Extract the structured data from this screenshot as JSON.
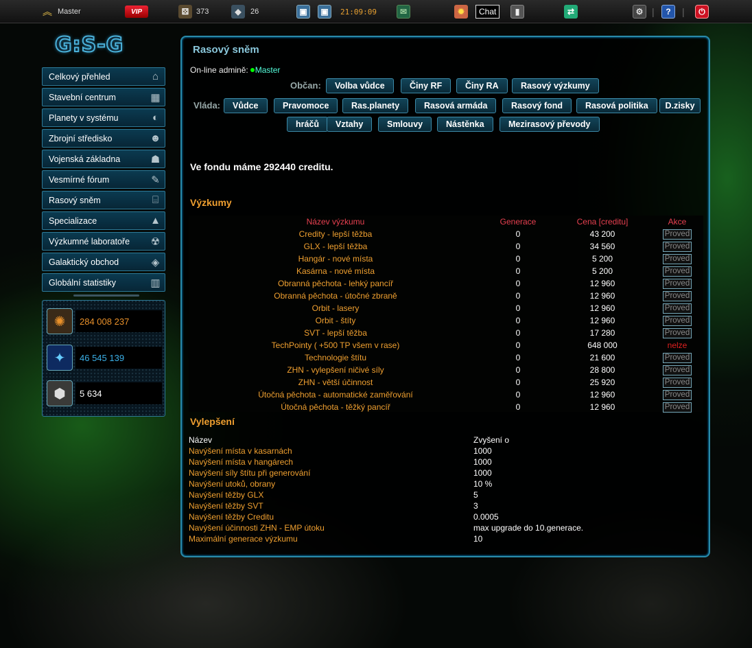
{
  "topbar": {
    "rank_icon": "rank-chevron-icon",
    "username": "Master",
    "vip": "VIP",
    "dice_value": "373",
    "ships_value": "26",
    "time": "21:09:09",
    "chat": "Chat"
  },
  "logo": "G:S-G",
  "sidebar": {
    "items": [
      {
        "label": "Celkový přehled",
        "icon": "home-icon"
      },
      {
        "label": "Stavební centrum",
        "icon": "building-icon"
      },
      {
        "label": "Planety v systému",
        "icon": "planet-icon"
      },
      {
        "label": "Zbrojní středisko",
        "icon": "soldier-icon"
      },
      {
        "label": "Vojenská základna",
        "icon": "base-icon"
      },
      {
        "label": "Vesmírné fórum",
        "icon": "forum-icon"
      },
      {
        "label": "Rasový sněm",
        "icon": "parliament-icon"
      },
      {
        "label": "Specializace",
        "icon": "specialization-icon"
      },
      {
        "label": "Výzkumné laboratoře",
        "icon": "radiation-icon"
      },
      {
        "label": "Galaktický obchod",
        "icon": "trade-icon"
      },
      {
        "label": "Globální statistiky",
        "icon": "stats-icon"
      }
    ]
  },
  "resources": {
    "credits": "284 008 237",
    "glx": "46 545 139",
    "svt": "5 634"
  },
  "colors": {
    "accent": "#2a8aa8",
    "orange": "#f0a030",
    "header_red": "#e84050",
    "credits": "#e8902a",
    "glx": "#3ab0e8"
  },
  "panel": {
    "title": "Rasový sněm",
    "online_label": "On-line admině:",
    "online_user": "Master",
    "obcan_label": "Občan:",
    "obcan_buttons": [
      "Volba vůdce",
      "Činy RF",
      "Činy RA",
      "Rasový výzkumy"
    ],
    "vlada_label": "Vláda:",
    "vlada_buttons": [
      "Vůdce",
      "Pravomoce",
      "Ras.planety",
      "Rasová armáda",
      "Rasový fond",
      "Rasová politika",
      "D.zisky",
      "hráčů",
      "Vztahy",
      "Smlouvy",
      "Nástěnka",
      "Mezirasový převody"
    ],
    "fund_text": "Ve fondu máme 292440 creditu."
  },
  "research": {
    "title": "Výzkumy",
    "headers": {
      "name": "Název výzkumu",
      "gen": "Generace",
      "cost": "Cena [creditu]",
      "action": "Akce"
    },
    "action_label": "Proved",
    "na_label": "nelze",
    "rows": [
      {
        "name": "Credity - lepší těžba",
        "gen": "0",
        "cost": "43 200",
        "available": true
      },
      {
        "name": "GLX - lepší těžba",
        "gen": "0",
        "cost": "34 560",
        "available": true
      },
      {
        "name": "Hangár - nové místa",
        "gen": "0",
        "cost": "5 200",
        "available": true
      },
      {
        "name": "Kasárna - nové místa",
        "gen": "0",
        "cost": "5 200",
        "available": true
      },
      {
        "name": "Obranná pěchota - lehký pancíř",
        "gen": "0",
        "cost": "12 960",
        "available": true
      },
      {
        "name": "Obranná pěchota - útočné zbraně",
        "gen": "0",
        "cost": "12 960",
        "available": true
      },
      {
        "name": "Orbit - lasery",
        "gen": "0",
        "cost": "12 960",
        "available": true
      },
      {
        "name": "Orbit - štíty",
        "gen": "0",
        "cost": "12 960",
        "available": true
      },
      {
        "name": "SVT - lepší těžba",
        "gen": "0",
        "cost": "17 280",
        "available": true
      },
      {
        "name": "TechPointy ( +500 TP všem v rase)",
        "gen": "0",
        "cost": "648 000",
        "available": false
      },
      {
        "name": "Technologie štítu",
        "gen": "0",
        "cost": "21 600",
        "available": true
      },
      {
        "name": "ZHN - vylepšení ničivé síly",
        "gen": "0",
        "cost": "28 800",
        "available": true
      },
      {
        "name": "ZHN - větší účinnost",
        "gen": "0",
        "cost": "25 920",
        "available": true
      },
      {
        "name": "Útočná pěchota - automatické zaměřování",
        "gen": "0",
        "cost": "12 960",
        "available": true
      },
      {
        "name": "Útočná pěchota - těžký pancíř",
        "gen": "0",
        "cost": "12 960",
        "available": true
      }
    ]
  },
  "upgrades": {
    "title": "Vylepšení",
    "headers": {
      "name": "Název",
      "value": "Zvyšení o"
    },
    "rows": [
      {
        "name": "Navýšení místa v kasarnách",
        "value": "1000"
      },
      {
        "name": "Navýšení místa v hangárech",
        "value": "1000"
      },
      {
        "name": "Navýšení síly štítu při generování",
        "value": "1000"
      },
      {
        "name": "Navýšení utoků, obrany",
        "value": "10 %"
      },
      {
        "name": "Navýšení těžby GLX",
        "value": "5"
      },
      {
        "name": "Navýšení těžby SVT",
        "value": "3"
      },
      {
        "name": "Navýšení těžby Creditu",
        "value": "0.0005"
      },
      {
        "name": "Navýšení účinnosti ZHN - EMP útoku",
        "value": "max upgrade do 10.generace."
      },
      {
        "name": "Maximální generace výzkumu",
        "value": "10"
      }
    ]
  }
}
